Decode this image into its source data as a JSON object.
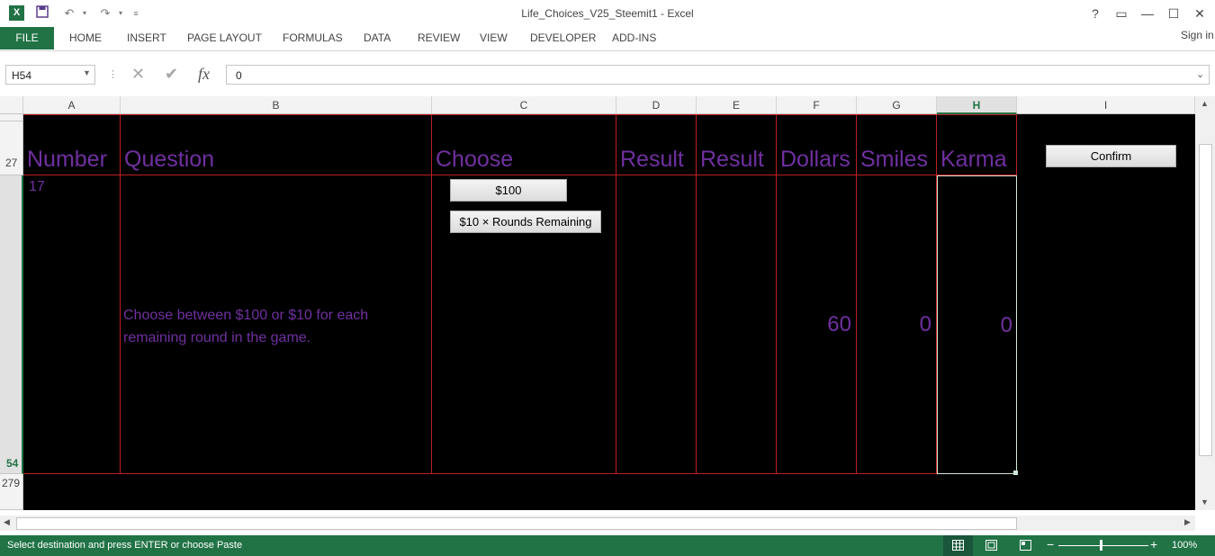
{
  "window": {
    "title": "Life_Choices_V25_Steemit1 - Excel"
  },
  "quick_access": {
    "excel_icon": "excel-logo-icon",
    "save_icon": "save-icon",
    "undo_icon": "undo-icon",
    "redo_icon": "redo-icon",
    "customize_icon": "customize-icon"
  },
  "window_controls": {
    "help": "?",
    "ribbon_display": "▭",
    "minimize": "—",
    "maximize": "☐",
    "close": "✕"
  },
  "ribbon": {
    "file": "FILE",
    "tabs": [
      "HOME",
      "INSERT",
      "PAGE LAYOUT",
      "FORMULAS",
      "DATA",
      "REVIEW",
      "VIEW",
      "DEVELOPER",
      "ADD-INS"
    ],
    "sign_in": "Sign in"
  },
  "formula_bar": {
    "name_box": "H54",
    "cancel": "✕",
    "enter": "✔",
    "fx": "fx",
    "value": "0"
  },
  "columns": [
    "A",
    "B",
    "C",
    "D",
    "E",
    "F",
    "G",
    "H",
    "I"
  ],
  "rows": {
    "header_row": "27",
    "data_row": "54",
    "next_row": "279"
  },
  "table": {
    "headers": [
      "Number",
      "Question",
      "Choose",
      "Result",
      "Result",
      "Dollars",
      "Smiles",
      "Karma"
    ],
    "row": {
      "number": "17",
      "question": "Choose between $100 or $10 for each remaining round in the game.",
      "dollars": "60",
      "smiles": "0",
      "karma": "0"
    }
  },
  "buttons": {
    "option_100": "$100",
    "option_10": "$10 × Rounds Remaining",
    "confirm": "Confirm"
  },
  "status": {
    "message": "Select destination and press ENTER or choose Paste",
    "zoom": "100%"
  },
  "colors": {
    "accent": "#217346",
    "text": "#7030a0",
    "grid_line": "#c11e1e",
    "sheet_bg": "#000000"
  }
}
